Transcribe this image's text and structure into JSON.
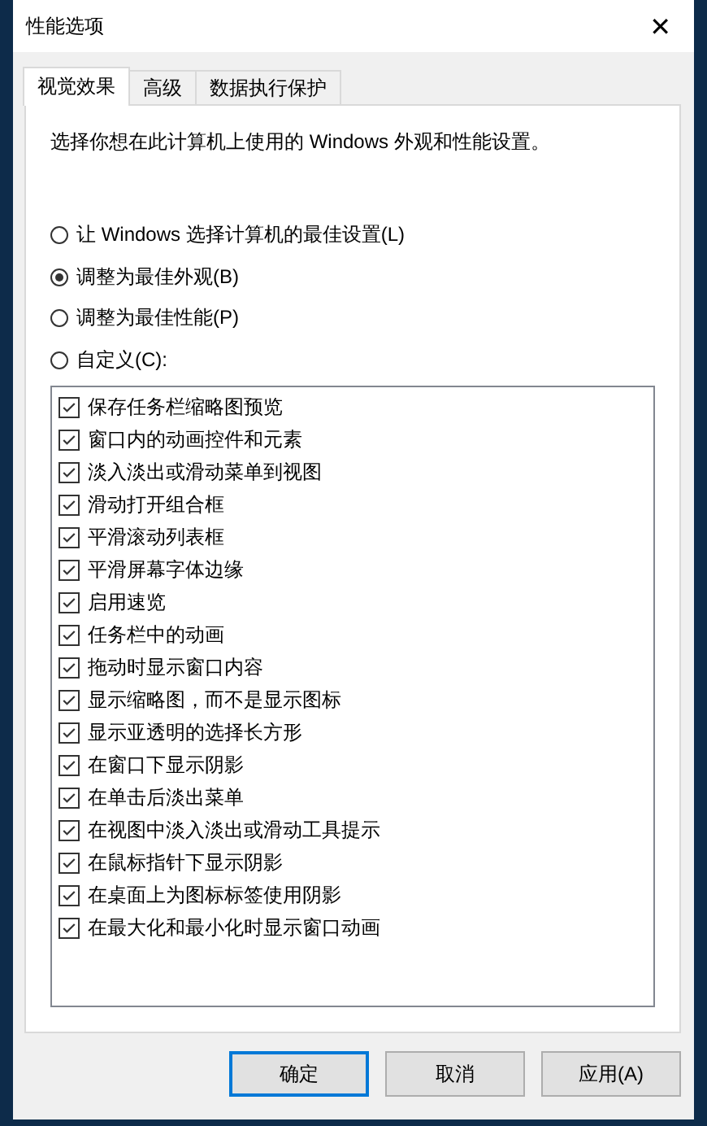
{
  "window": {
    "title": "性能选项",
    "close": "✕"
  },
  "tabs": [
    {
      "label": "视觉效果",
      "selected": true
    },
    {
      "label": "高级",
      "selected": false
    },
    {
      "label": "数据执行保护",
      "selected": false
    }
  ],
  "description": "选择你想在此计算机上使用的 Windows 外观和性能设置。",
  "options": [
    {
      "label": "让 Windows 选择计算机的最佳设置(L)",
      "selected": false
    },
    {
      "label": "调整为最佳外观(B)",
      "selected": true
    },
    {
      "label": "调整为最佳性能(P)",
      "selected": false
    },
    {
      "label": "自定义(C):",
      "selected": false
    }
  ],
  "effects": [
    {
      "label": "保存任务栏缩略图预览",
      "checked": true
    },
    {
      "label": "窗口内的动画控件和元素",
      "checked": true
    },
    {
      "label": "淡入淡出或滑动菜单到视图",
      "checked": true
    },
    {
      "label": "滑动打开组合框",
      "checked": true
    },
    {
      "label": "平滑滚动列表框",
      "checked": true
    },
    {
      "label": "平滑屏幕字体边缘",
      "checked": true
    },
    {
      "label": "启用速览",
      "checked": true
    },
    {
      "label": "任务栏中的动画",
      "checked": true
    },
    {
      "label": "拖动时显示窗口内容",
      "checked": true
    },
    {
      "label": "显示缩略图，而不是显示图标",
      "checked": true
    },
    {
      "label": "显示亚透明的选择长方形",
      "checked": true
    },
    {
      "label": "在窗口下显示阴影",
      "checked": true
    },
    {
      "label": "在单击后淡出菜单",
      "checked": true
    },
    {
      "label": "在视图中淡入淡出或滑动工具提示",
      "checked": true
    },
    {
      "label": "在鼠标指针下显示阴影",
      "checked": true
    },
    {
      "label": "在桌面上为图标标签使用阴影",
      "checked": true
    },
    {
      "label": "在最大化和最小化时显示窗口动画",
      "checked": true
    }
  ],
  "buttons": [
    {
      "label": "确定",
      "default": true
    },
    {
      "label": "取消",
      "default": false
    },
    {
      "label": "应用(A)",
      "default": false
    }
  ]
}
